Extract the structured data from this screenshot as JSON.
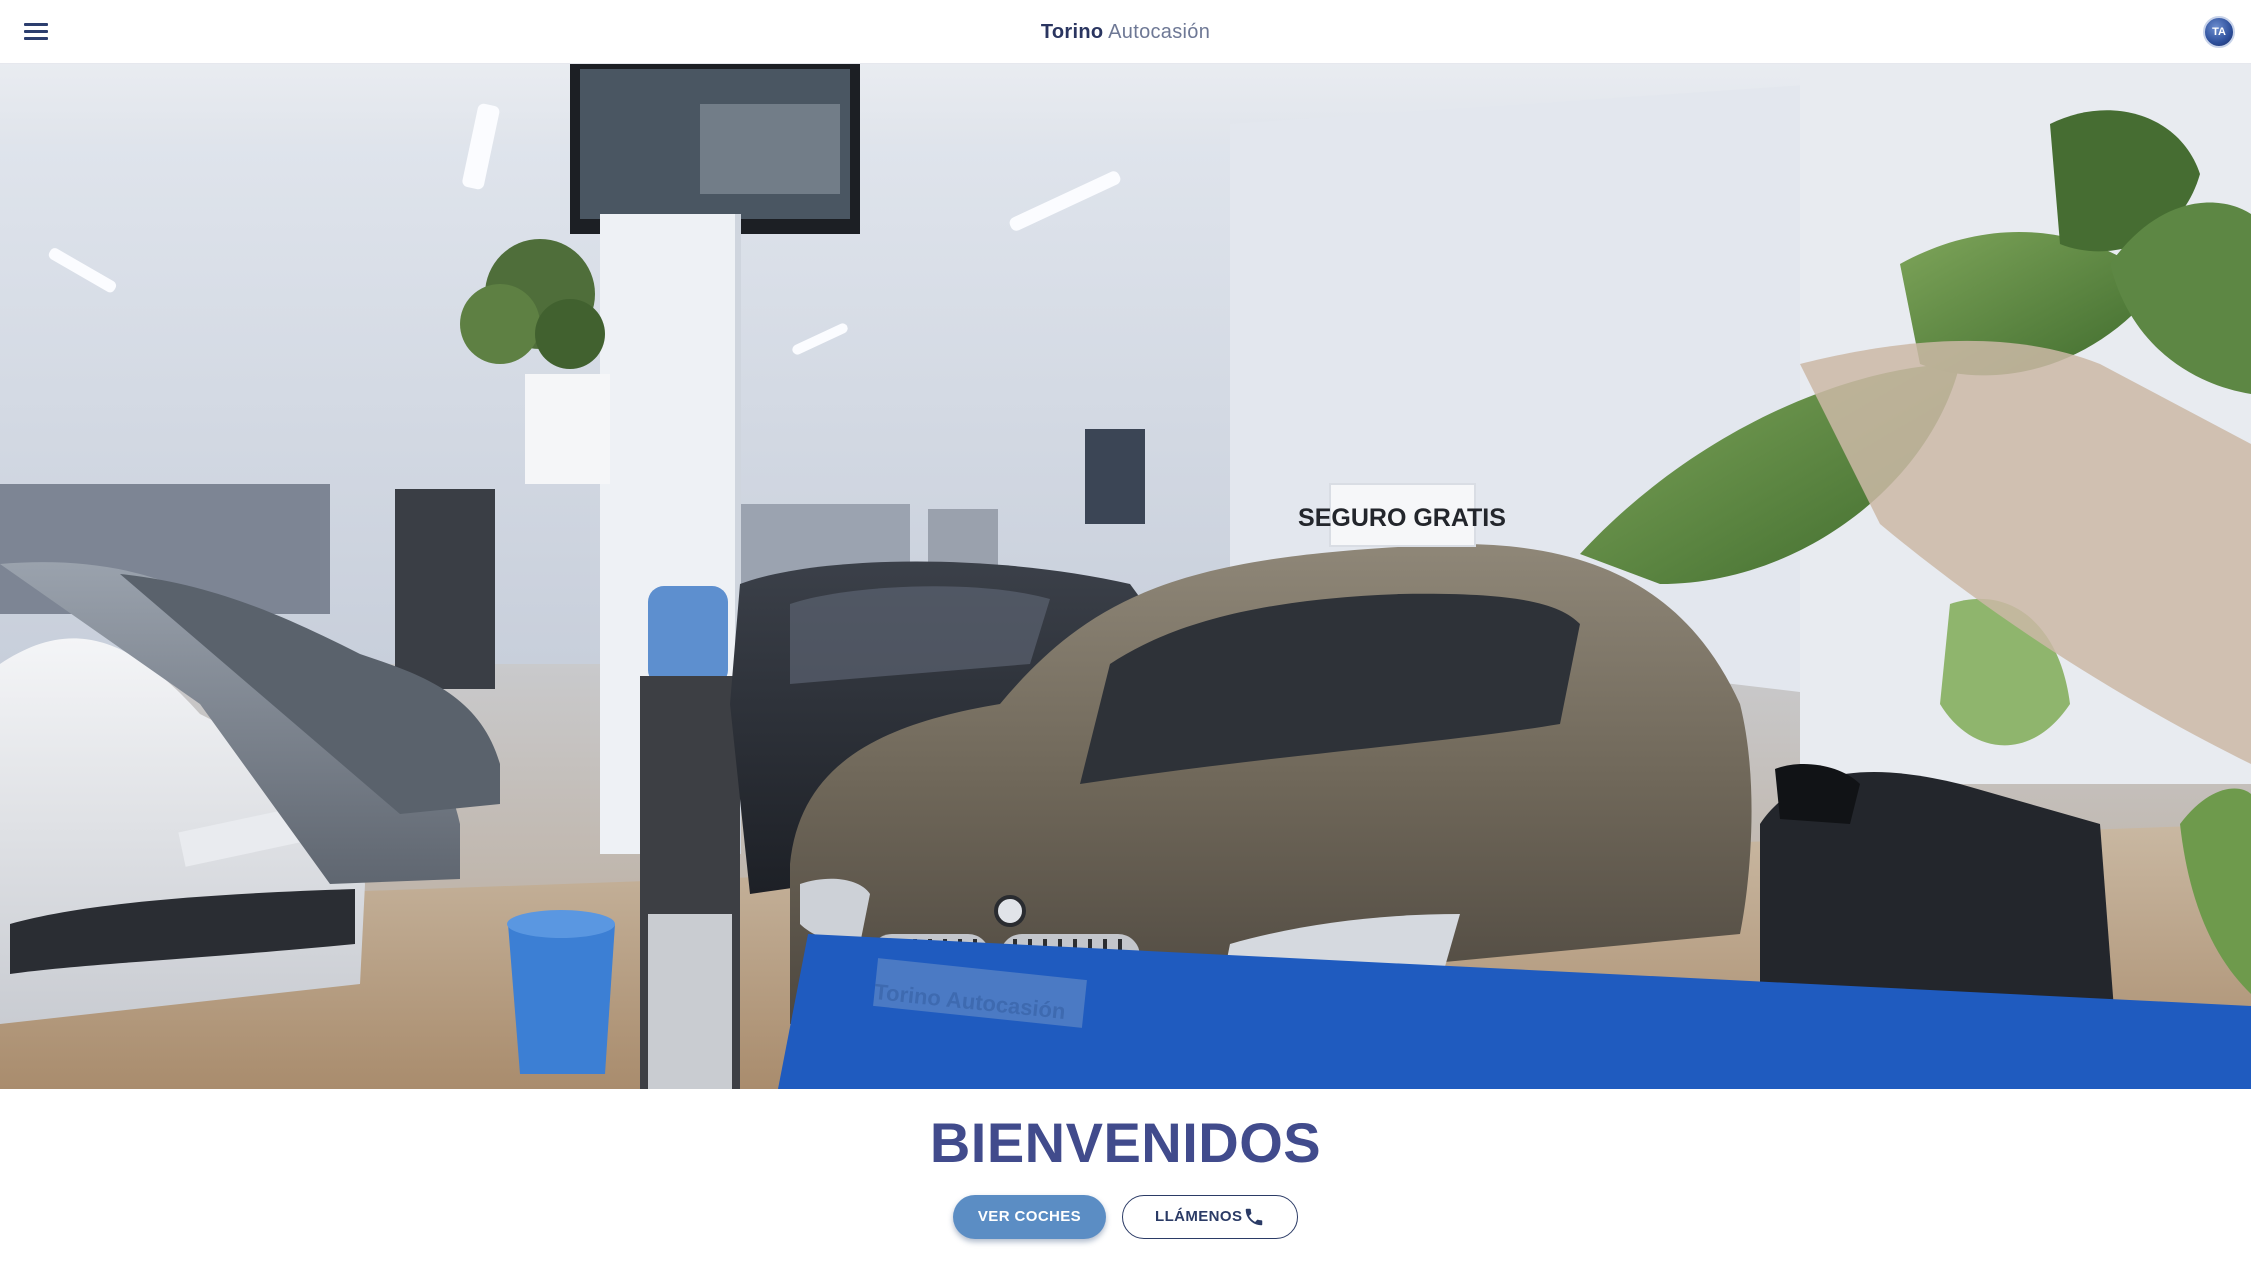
{
  "header": {
    "brand_strong": "Torino",
    "brand_light": "Autocasión",
    "menu_icon": "hamburger-menu-icon",
    "logo_icon": "ta-brand-logo",
    "logo_text": "TA"
  },
  "hero": {
    "sign_text": "SEGURO GRATIS",
    "plate_text": "Torino Autocasión",
    "banner_text": "Torino Autocasión"
  },
  "welcome": {
    "title": "BIENVENIDOS",
    "cta_primary": "VER COCHES",
    "cta_secondary": "LLÁMENOS",
    "cta_secondary_icon": "phone-icon"
  },
  "colors": {
    "brand_dark": "#2a3560",
    "title": "#414b8c",
    "primary_button": "#5b8dc4",
    "banner_blue": "#1f5bbf"
  }
}
